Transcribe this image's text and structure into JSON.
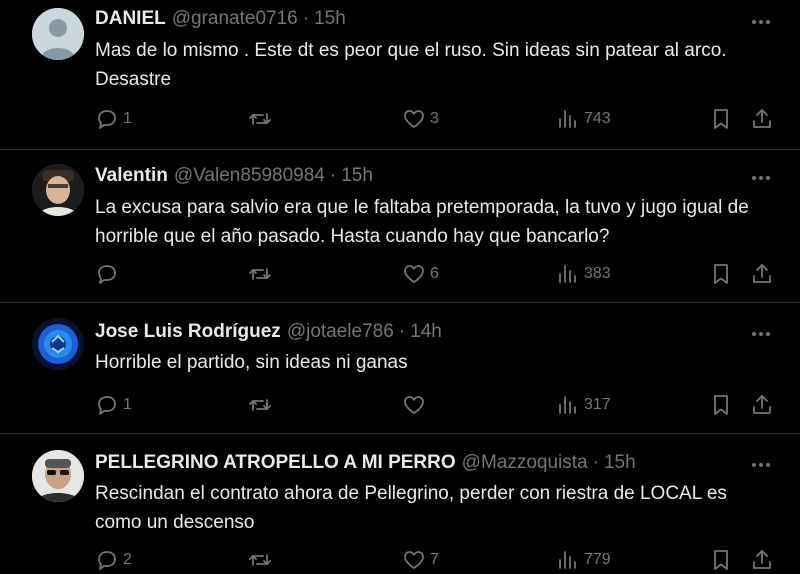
{
  "tweets": [
    {
      "name": "DANIEL",
      "handle": "@granate0716",
      "time": "15h",
      "text": "Mas de lo mismo . Este dt es peor que el ruso. Sin ideas sin patear al arco. Desastre",
      "replies": "1",
      "retweets": "",
      "likes": "3",
      "views": "743",
      "avatar": "default-avatar"
    },
    {
      "name": "Valentin",
      "handle": "@Valen85980984",
      "time": "15h",
      "text": "La excusa para salvio era que le faltaba pretemporada, la tuvo y jugo igual de horrible que el año pasado. Hasta cuando hay que bancarlo?",
      "replies": "",
      "retweets": "",
      "likes": "6",
      "views": "383",
      "avatar": "photo-avatar"
    },
    {
      "name": "Jose Luis Rodríguez",
      "handle": "@jotaele786",
      "time": "14h",
      "text": "Horrible el partido, sin ideas ni ganas",
      "replies": "1",
      "retweets": "",
      "likes": "",
      "views": "317",
      "avatar": "blue-logo-avatar"
    },
    {
      "name": "PELLEGRINO ATROPELLO A MI PERRO",
      "handle": "@Mazzoquista",
      "time": "15h",
      "text": "Rescindan el contrato ahora de Pellegrino, perder con riestra de LOCAL es como un descenso",
      "replies": "2",
      "retweets": "",
      "likes": "7",
      "views": "779",
      "avatar": "photo-avatar-sunglasses"
    }
  ],
  "colors": {
    "background": "#000000",
    "text": "#e7e9ea",
    "muted": "#71767b",
    "divider": "#2f3336"
  },
  "icons": [
    "reply-icon",
    "retweet-icon",
    "like-icon",
    "views-icon",
    "bookmark-icon",
    "share-icon",
    "more-icon"
  ]
}
